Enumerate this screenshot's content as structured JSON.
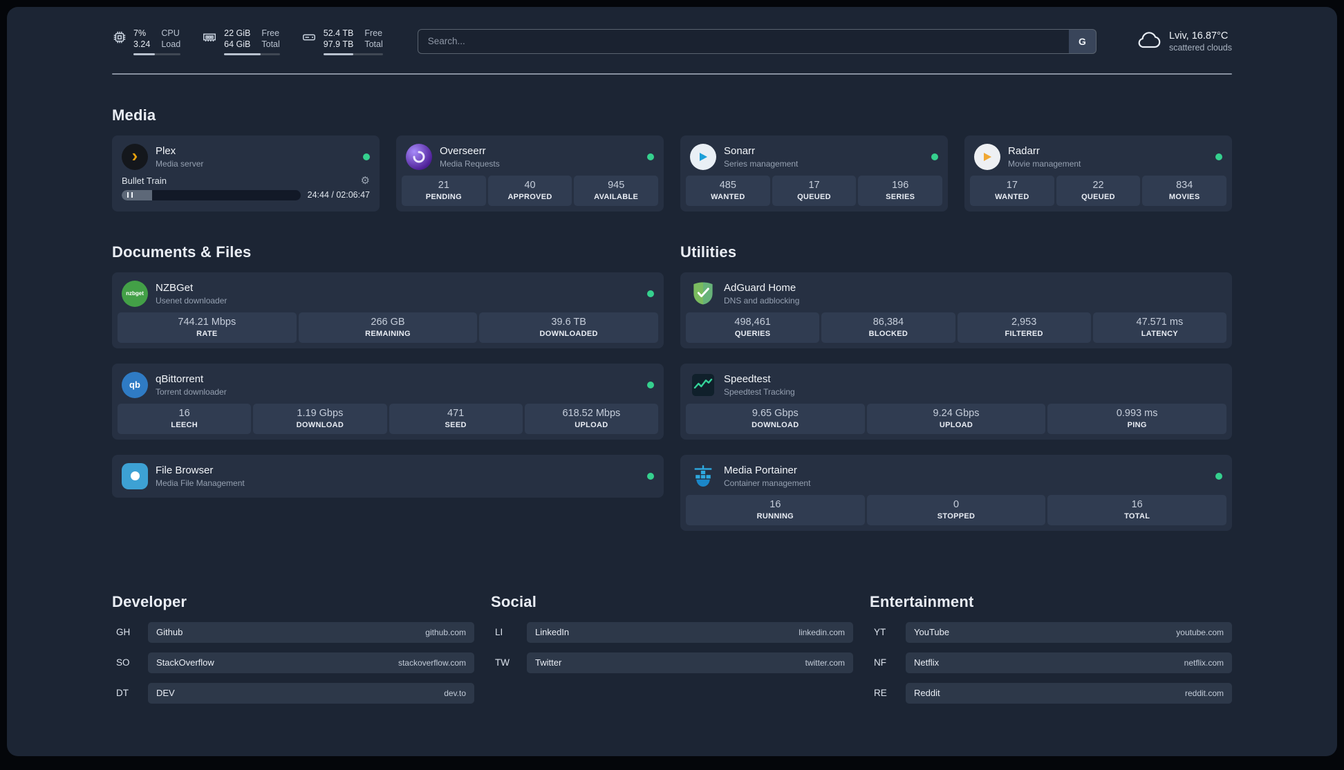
{
  "theme": {
    "background": "#1c2534",
    "card": "#263042",
    "status_green": "#35d08e",
    "accent_amber": "#e5a00d"
  },
  "topbar": {
    "resources": [
      {
        "icon": "cpu-icon",
        "rows": [
          {
            "value": "7%",
            "label": "CPU"
          },
          {
            "value": "3.24",
            "label": "Load"
          }
        ],
        "bar_style": "width:45%"
      },
      {
        "icon": "memory-icon",
        "rows": [
          {
            "value": "22 GiB",
            "label": "Free"
          },
          {
            "value": "64 GiB",
            "label": "Total"
          }
        ],
        "bar_style": "width:66%"
      },
      {
        "icon": "disk-icon",
        "rows": [
          {
            "value": "52.4 TB",
            "label": "Free"
          },
          {
            "value": "97.9 TB",
            "label": "Total"
          }
        ],
        "bar_style": "width:50%"
      }
    ],
    "search": {
      "placeholder": "Search...",
      "provider": "G"
    },
    "weather": {
      "location": "Lviv, 16.87°C",
      "condition": "scattered clouds"
    }
  },
  "sections": {
    "media": {
      "title": "Media",
      "cards": {
        "plex": {
          "name": "Plex",
          "desc": "Media server",
          "player": {
            "track": "Bullet Train",
            "time": "24:44 / 02:06:47",
            "progress_style": "width:17%"
          }
        },
        "overseerr": {
          "name": "Overseerr",
          "desc": "Media Requests",
          "stats": [
            {
              "value": "21",
              "label": "PENDING"
            },
            {
              "value": "40",
              "label": "APPROVED"
            },
            {
              "value": "945",
              "label": "AVAILABLE"
            }
          ]
        },
        "sonarr": {
          "name": "Sonarr",
          "desc": "Series management",
          "stats": [
            {
              "value": "485",
              "label": "WANTED"
            },
            {
              "value": "17",
              "label": "QUEUED"
            },
            {
              "value": "196",
              "label": "SERIES"
            }
          ]
        },
        "radarr": {
          "name": "Radarr",
          "desc": "Movie management",
          "stats": [
            {
              "value": "17",
              "label": "WANTED"
            },
            {
              "value": "22",
              "label": "QUEUED"
            },
            {
              "value": "834",
              "label": "MOVIES"
            }
          ]
        }
      }
    },
    "documents": {
      "title": "Documents & Files",
      "cards": {
        "nzbget": {
          "name": "NZBGet",
          "desc": "Usenet downloader",
          "icon_text": "nzbget",
          "stats": [
            {
              "value": "744.21 Mbps",
              "label": "RATE"
            },
            {
              "value": "266 GB",
              "label": "REMAINING"
            },
            {
              "value": "39.6 TB",
              "label": "DOWNLOADED"
            }
          ]
        },
        "qbittorrent": {
          "name": "qBittorrent",
          "desc": "Torrent downloader",
          "icon_text": "qb",
          "stats": [
            {
              "value": "16",
              "label": "LEECH"
            },
            {
              "value": "1.19 Gbps",
              "label": "DOWNLOAD"
            },
            {
              "value": "471",
              "label": "SEED"
            },
            {
              "value": "618.52 Mbps",
              "label": "UPLOAD"
            }
          ]
        },
        "filebrowser": {
          "name": "File Browser",
          "desc": "Media File Management"
        }
      }
    },
    "utilities": {
      "title": "Utilities",
      "cards": {
        "adguard": {
          "name": "AdGuard Home",
          "desc": "DNS and adblocking",
          "stats": [
            {
              "value": "498,461",
              "label": "QUERIES"
            },
            {
              "value": "86,384",
              "label": "BLOCKED"
            },
            {
              "value": "2,953",
              "label": "FILTERED"
            },
            {
              "value": "47.571 ms",
              "label": "LATENCY"
            }
          ]
        },
        "speedtest": {
          "name": "Speedtest",
          "desc": "Speedtest Tracking",
          "stats": [
            {
              "value": "9.65 Gbps",
              "label": "DOWNLOAD"
            },
            {
              "value": "9.24 Gbps",
              "label": "UPLOAD"
            },
            {
              "value": "0.993 ms",
              "label": "PING"
            }
          ]
        },
        "portainer": {
          "name": "Media Portainer",
          "desc": "Container management",
          "stats": [
            {
              "value": "16",
              "label": "RUNNING"
            },
            {
              "value": "0",
              "label": "STOPPED"
            },
            {
              "value": "16",
              "label": "TOTAL"
            }
          ]
        }
      }
    },
    "bookmarks": {
      "developer": {
        "title": "Developer",
        "items": [
          {
            "abbr": "GH",
            "name": "Github",
            "domain": "github.com"
          },
          {
            "abbr": "SO",
            "name": "StackOverflow",
            "domain": "stackoverflow.com"
          },
          {
            "abbr": "DT",
            "name": "DEV",
            "domain": "dev.to"
          }
        ]
      },
      "social": {
        "title": "Social",
        "items": [
          {
            "abbr": "LI",
            "name": "LinkedIn",
            "domain": "linkedin.com"
          },
          {
            "abbr": "TW",
            "name": "Twitter",
            "domain": "twitter.com"
          }
        ]
      },
      "entertainment": {
        "title": "Entertainment",
        "items": [
          {
            "abbr": "YT",
            "name": "YouTube",
            "domain": "youtube.com"
          },
          {
            "abbr": "NF",
            "name": "Netflix",
            "domain": "netflix.com"
          },
          {
            "abbr": "RE",
            "name": "Reddit",
            "domain": "reddit.com"
          }
        ]
      }
    }
  }
}
